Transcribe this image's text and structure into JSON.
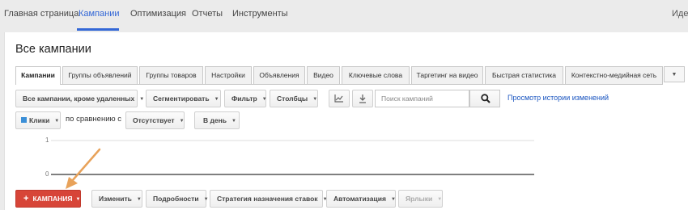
{
  "nav": {
    "items": [
      "Главная страница",
      "Кампании",
      "Оптимизация",
      "Отчеты",
      "Инструменты"
    ],
    "active_index": 1,
    "user": "Иде"
  },
  "page": {
    "title": "Все кампании"
  },
  "tabs": [
    "Кампании",
    "Группы объявлений",
    "Группы товаров",
    "Настройки",
    "Объявления",
    "Видео",
    "Ключевые слова",
    "Таргетинг на видео",
    "Быстрая статистика",
    "Контекстно-медийная сеть"
  ],
  "tabs_more_icon": "caret-down-icon",
  "toolbar": {
    "filter_campaigns": "Все кампании, кроме удаленных",
    "segment": "Сегментировать",
    "filter": "Фильтр",
    "columns": "Столбцы",
    "chart_icon": "line-chart-icon",
    "download_icon": "download-icon",
    "search_placeholder": "Поиск кампаний",
    "search_icon": "magnifier-icon",
    "history_link": "Просмотр истории изменений"
  },
  "chart_controls": {
    "metric": "Клики",
    "metric_color": "#3b8fd7",
    "compare_label": "по сравнению с",
    "compare_value": "Отсутствует",
    "period": "В день"
  },
  "chart_data": {
    "type": "line",
    "y_ticks": [
      "1",
      "0"
    ],
    "ylim": [
      0,
      1
    ],
    "series": [
      {
        "values": [
          0
        ]
      }
    ]
  },
  "bottom_toolbar": {
    "add_campaign": "КАМПАНИЯ",
    "edit": "Изменить",
    "details": "Подробности",
    "bid_strategy": "Стратегия назначения ставок",
    "automate": "Автоматизация",
    "labels": "Ярлыки"
  },
  "colors": {
    "accent": "#3367d6",
    "primary_red": "#d74538",
    "arrow": "#e8a25a"
  }
}
